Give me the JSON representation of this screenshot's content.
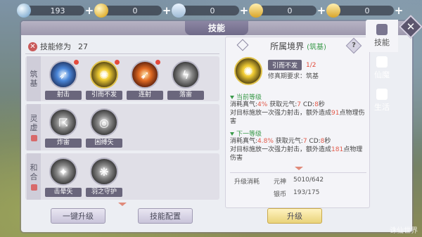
{
  "currencies": [
    {
      "name": "silver-coin-icon",
      "value": "193"
    },
    {
      "name": "gold-coin-icon",
      "value": "0"
    },
    {
      "name": "silver-ingot-icon",
      "value": "0"
    },
    {
      "name": "gold-ingot-icon",
      "value": "0"
    },
    {
      "name": "gold-ingot-2-icon",
      "value": "0"
    }
  ],
  "window": {
    "title": "技能",
    "close_glyph": "✕"
  },
  "mastery": {
    "label": "技能修为",
    "value": "27"
  },
  "realms": [
    {
      "name": "筑\n基",
      "skills": [
        {
          "name": "射击",
          "icon": "blue-arrow-icon",
          "dot": true
        },
        {
          "name": "引而不发",
          "icon": "gold-burst-icon",
          "dot": true
        },
        {
          "name": "连射",
          "icon": "red-arrows-icon",
          "dot": true
        },
        {
          "name": "落雷",
          "icon": "lightning-icon",
          "dot": false
        }
      ]
    },
    {
      "name": "灵\n虚",
      "skills": [
        {
          "name": "炸雷",
          "icon": "thunder-icon",
          "dot": false
        },
        {
          "name": "困缚矢",
          "icon": "bind-arrow-icon",
          "dot": false
        }
      ]
    },
    {
      "name": "和\n合",
      "skills": [
        {
          "name": "击晕矢",
          "icon": "stun-arrow-icon",
          "dot": false
        },
        {
          "name": "羽之守护",
          "icon": "feather-guard-icon",
          "dot": false
        }
      ]
    }
  ],
  "buttons": {
    "one_key_upgrade": "一键升级",
    "skill_config": "技能配置",
    "upgrade": "升级"
  },
  "detail": {
    "header": "所属境界",
    "header_realm": "(筑基)",
    "help": "?",
    "skill_name": "引而不发",
    "skill_level": "1/2",
    "requirement": "修真期要求：筑基",
    "current_title": "当前等级",
    "current_line1_a": "消耗真气:",
    "current_line1_b": "4%",
    "current_line1_c": "   获取元气:",
    "current_line1_d": "7",
    "current_line1_e": "  CD:",
    "current_line1_f": "8",
    "current_line1_g": "秒",
    "current_line2": "对目标施放一次强力射击，额外造成",
    "current_dmg": "91",
    "current_line3": "点物理伤害",
    "next_title": "下一等级",
    "next_line1_b": "4.8%",
    "next_dmg": "181",
    "cost_label": "升级消耗",
    "cost_yuanshen_label": "元神",
    "cost_yuanshen": "5010/642",
    "cost_silver_label": "银币",
    "cost_silver": "193/175"
  },
  "tabs": [
    {
      "label": "技能",
      "active": true
    },
    {
      "label": "仙魔",
      "active": false
    },
    {
      "label": "生活",
      "active": false
    }
  ],
  "watermark": "诛仙世界"
}
